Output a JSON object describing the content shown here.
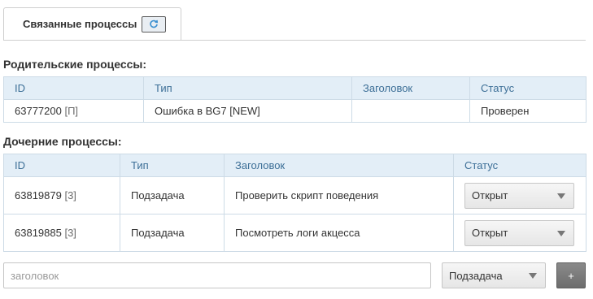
{
  "tab": {
    "label": "Связанные процессы",
    "refresh_icon": "refresh-icon"
  },
  "parents": {
    "title": "Родительские процессы:",
    "headers": [
      "ID",
      "Тип",
      "Заголовок",
      "Статус"
    ],
    "rows": [
      {
        "id": "63777200",
        "suffix": "[П]",
        "type": "Ошибка в BG7 [NEW]",
        "title": "",
        "status": "Проверен"
      }
    ]
  },
  "children": {
    "title": "Дочерние процессы:",
    "headers": [
      "ID",
      "Тип",
      "Заголовок",
      "Статус"
    ],
    "rows": [
      {
        "id": "63819879",
        "suffix": "[3]",
        "type": "Подзадача",
        "title": "Проверить скрипт поведения",
        "status": "Открыт"
      },
      {
        "id": "63819885",
        "suffix": "[3]",
        "type": "Подзадача",
        "title": "Посмотреть логи акцесса",
        "status": "Открыт"
      }
    ]
  },
  "new_child": {
    "placeholder": "заголовок",
    "type_value": "Подзадача",
    "add_label": "+"
  },
  "colors": {
    "header_bg": "#e3eef7",
    "header_text": "#3d6f97",
    "border": "#cddbe6",
    "refresh_icon": "#3a8fd0"
  }
}
